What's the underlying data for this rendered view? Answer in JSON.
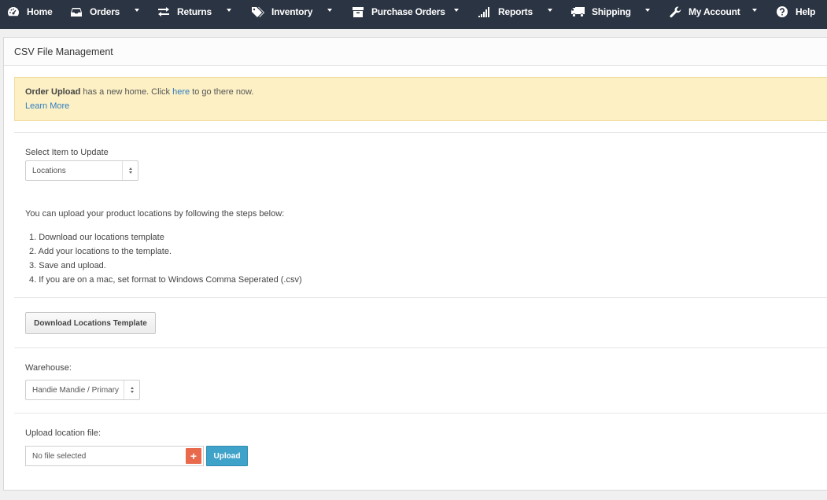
{
  "nav": [
    {
      "label": "Home",
      "icon": "dashboard-icon",
      "caret": false
    },
    {
      "label": "Orders",
      "icon": "inbox-icon",
      "caret": true
    },
    {
      "label": "Returns",
      "icon": "exchange-icon",
      "caret": true
    },
    {
      "label": "Inventory",
      "icon": "tags-icon",
      "caret": true
    },
    {
      "label": "Purchase Orders",
      "icon": "archive-icon",
      "caret": true
    },
    {
      "label": "Reports",
      "icon": "signal-bars-icon",
      "caret": true
    },
    {
      "label": "Shipping",
      "icon": "truck-icon",
      "caret": true
    },
    {
      "label": "My Account",
      "icon": "wrench-icon",
      "caret": true
    },
    {
      "label": "Help",
      "icon": "question-circle-icon",
      "caret": false
    }
  ],
  "panel": {
    "title": "CSV File Management"
  },
  "alert": {
    "bold": "Order Upload",
    "text_before_link": " has a new home. Click ",
    "link": "here",
    "text_after_link": " to go there now.",
    "learn_more": "Learn More"
  },
  "item_select": {
    "label": "Select Item to Update",
    "value": "Locations"
  },
  "instructions": {
    "intro": "You can upload your product locations by following the steps below:",
    "steps": [
      "1. Download our locations template",
      "2. Add your locations to the template.",
      "3. Save and upload.",
      "4. If you are on a mac, set format to Windows Comma Seperated (.csv)"
    ]
  },
  "download_button": "Download Locations Template",
  "warehouse": {
    "label": "Warehouse:",
    "value": "Handie Mandie / Primary"
  },
  "upload": {
    "label": "Upload location file:",
    "file_value": "No file selected",
    "add_symbol": "+",
    "button": "Upload"
  },
  "colors": {
    "nav_bg": "#2b3442",
    "alert_bg": "#fcf0c4",
    "link": "#2f7dc1",
    "upload_btn": "#3fa2c9",
    "add_btn": "#e8694c"
  }
}
